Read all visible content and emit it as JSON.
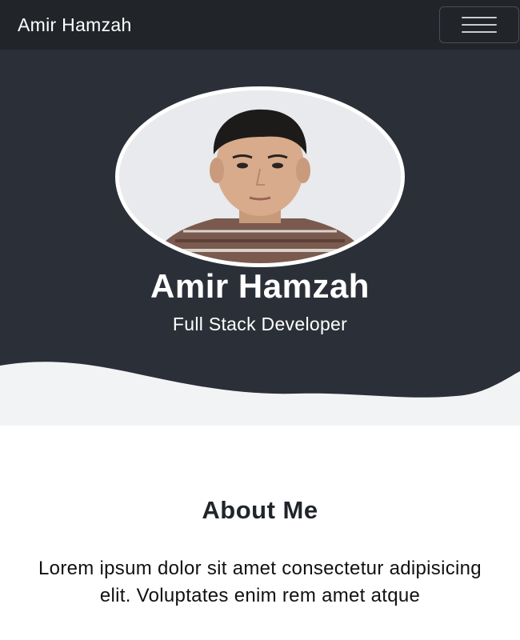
{
  "navbar": {
    "brand": "Amir Hamzah",
    "toggle_icon": "hamburger-menu-icon"
  },
  "hero": {
    "name": "Amir Hamzah",
    "role": "Full Stack Developer",
    "background_color": "#2b3038",
    "wave_color": "#f2f3f5"
  },
  "about": {
    "title": "About Me",
    "text": "Lorem ipsum dolor sit amet consectetur adipisicing elit. Voluptates enim rem amet atque"
  }
}
